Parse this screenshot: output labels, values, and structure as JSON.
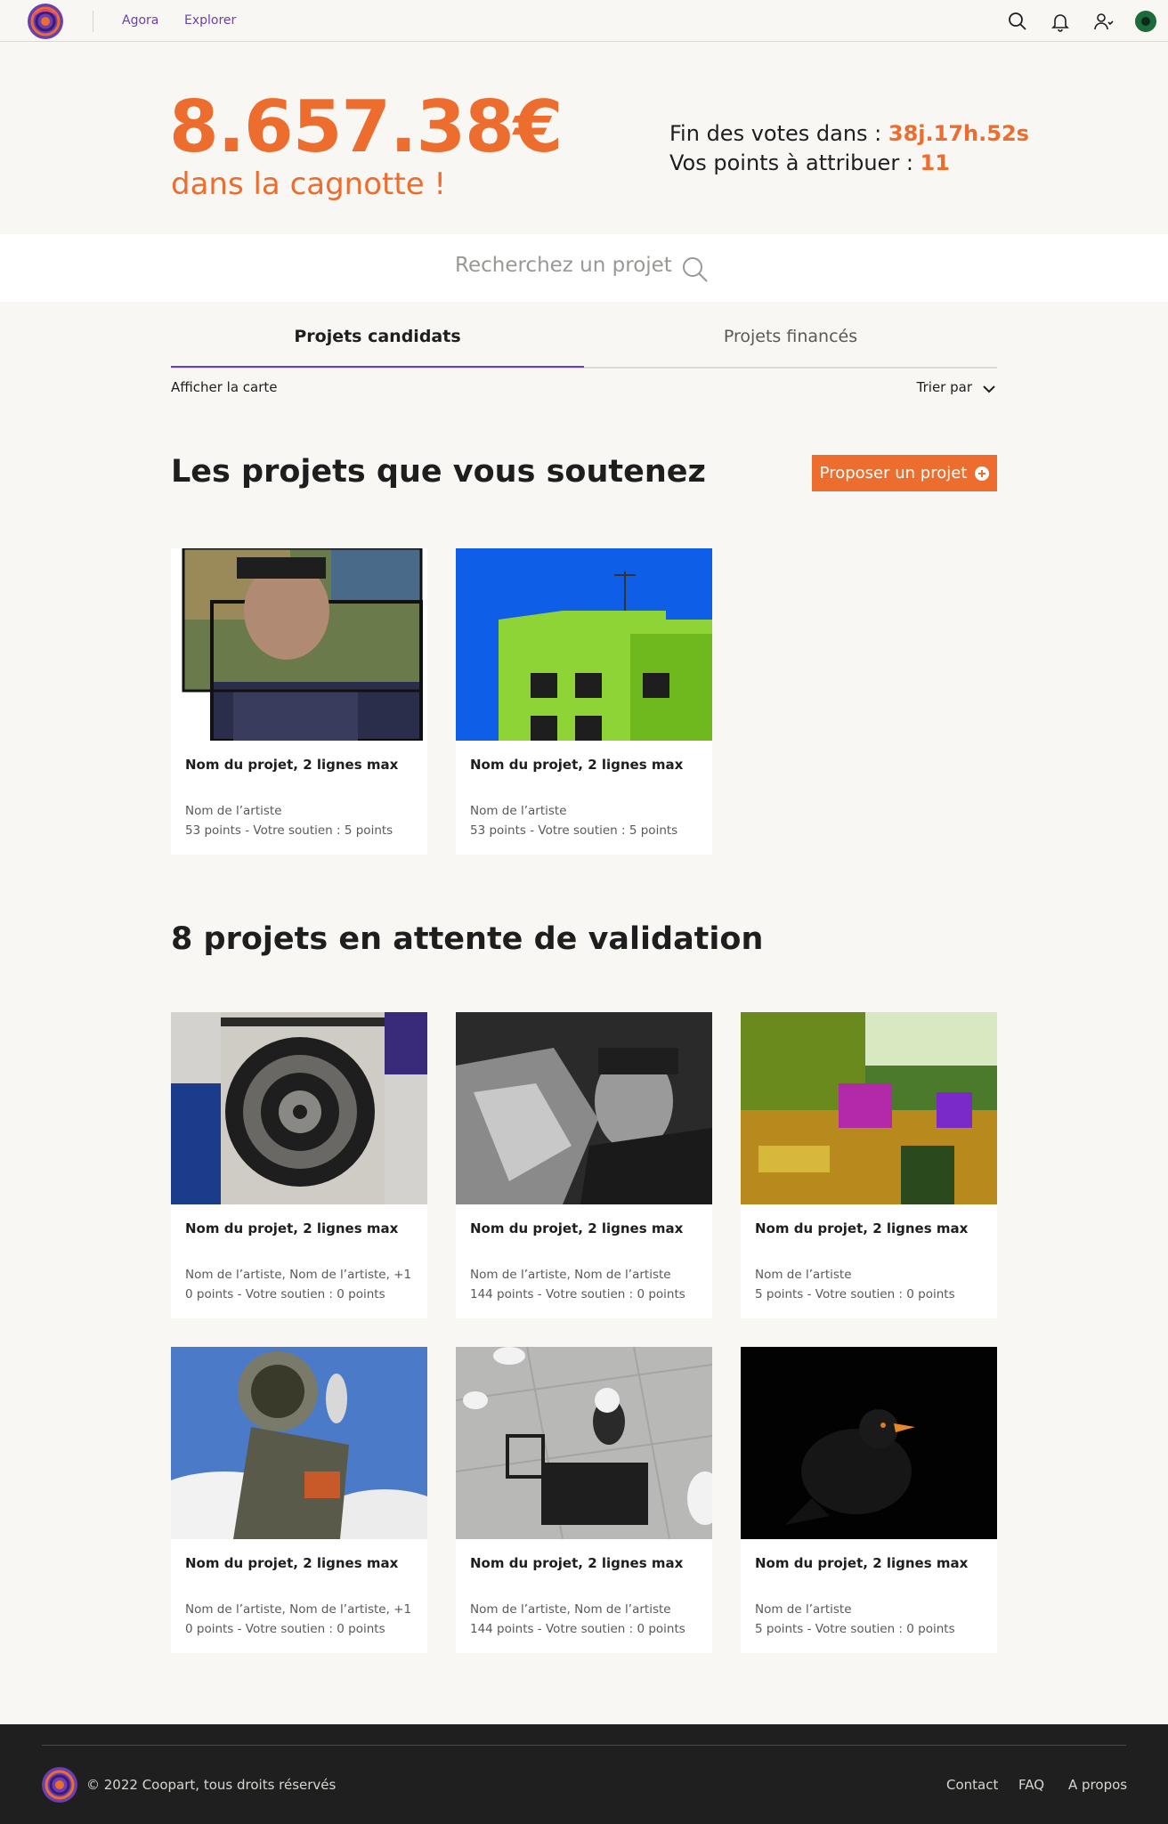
{
  "nav": {
    "links": [
      "Agora",
      "Explorer"
    ]
  },
  "hero": {
    "amount": "8.657.38€",
    "subtitle": "dans la cagnotte !",
    "end_label": "Fin des votes dans : ",
    "end_value": "38j.17h.52s",
    "points_label": "Vos points à attribuer : ",
    "points_value": "11"
  },
  "search": {
    "placeholder": "Recherchez un projet"
  },
  "tabs": [
    "Projets candidats",
    "Projets financés"
  ],
  "filters": {
    "map_label": "Afficher la carte",
    "sort_label": "Trier par"
  },
  "supported": {
    "title": "Les projets que vous soutenez",
    "propose_label": "Proposer un projet",
    "cards": [
      {
        "title": "Nom du projet, 2 lignes max",
        "artist": "Nom de l’artiste",
        "points": "53 points - Votre soutien : 5 points"
      },
      {
        "title": "Nom du projet, 2 lignes max",
        "artist": "Nom de l’artiste",
        "points": "53 points - Votre soutien : 5 points"
      }
    ]
  },
  "pending": {
    "title": "8 projets en attente de validation",
    "cards": [
      {
        "title": "Nom du projet, 2 lignes max",
        "artist": "Nom de l’artiste, Nom de l’artiste, +1",
        "points": "0 points - Votre soutien : 0 points"
      },
      {
        "title": "Nom du projet, 2 lignes max",
        "artist": "Nom de l’artiste, Nom de l’artiste",
        "points": "144 points - Votre soutien : 0 points"
      },
      {
        "title": "Nom du projet, 2 lignes max",
        "artist": "Nom de l’artiste",
        "points": "5 points - Votre soutien : 0 points"
      },
      {
        "title": "Nom du projet, 2 lignes max",
        "artist": "Nom de l’artiste, Nom de l’artiste, +1",
        "points": "0 points - Votre soutien : 0 points"
      },
      {
        "title": "Nom du projet, 2 lignes max",
        "artist": "Nom de l’artiste, Nom de l’artiste",
        "points": "144 points - Votre soutien : 0 points"
      },
      {
        "title": "Nom du projet, 2 lignes max",
        "artist": "Nom de l’artiste",
        "points": "5 points - Votre soutien : 0 points"
      }
    ]
  },
  "footer": {
    "copyright": "© 2022 Coopart, tous droits réservés",
    "links": [
      "Contact",
      "FAQ",
      "A propos"
    ]
  },
  "colors": {
    "accent": "#ec6d2d",
    "brand_purple": "#6a3fb0",
    "background": "#f8f7f3",
    "footer": "#1f1f1f"
  },
  "icons": [
    "logo-icon",
    "search-icon",
    "bell-icon",
    "user-add-icon",
    "avatar",
    "chevron-down-icon",
    "plus-circle-icon"
  ]
}
